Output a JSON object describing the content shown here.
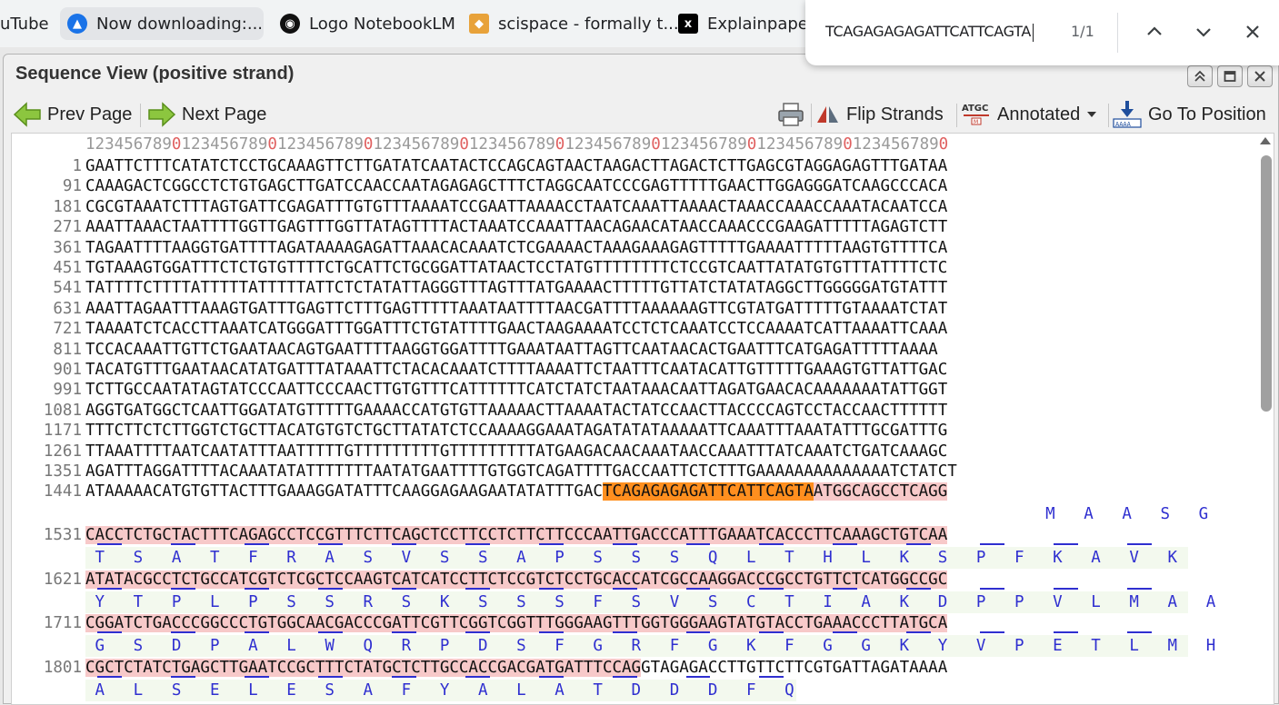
{
  "browser_tabs": [
    {
      "label": "uTube",
      "icon": "youtube-icon"
    },
    {
      "label": "Now downloading:...",
      "icon": "download-icon"
    },
    {
      "label": "Logo NotebookLM",
      "icon": "notebooklm-icon"
    },
    {
      "label": "scispace - formally t...",
      "icon": "scispace-icon"
    },
    {
      "label": "Explainpaper",
      "icon": "explainpaper-icon"
    }
  ],
  "find_bar": {
    "query": "TCAGAGAGAGATTCATTCAGTA",
    "count": "1/1"
  },
  "window": {
    "title": "Sequence View (positive strand)"
  },
  "toolbar": {
    "prev_page": "Prev Page",
    "next_page": "Next Page",
    "flip_strands": "Flip Strands",
    "annotated": "Annotated",
    "go_to_position": "Go To Position"
  },
  "ruler": "123456789012345678901234567890123456789012345678901234567890123456789012345678901234567890",
  "rows": [
    {
      "num": "1",
      "seq": "GAATTCTTTCATATCTCCTGCAAAGTTCTTGATATCAATACTCCAGCAGTAACTAAGACTTAGACTCTTGAGCGTAGGAGAGTTTGATAA"
    },
    {
      "num": "91",
      "seq": "CAAAGACTCGGCCTCTGTGAGCTTGATCCAACCAATAGAGAGCTTTCTAGGCAATCCCGAGTTTTTGAACTTGGAGGGATCAAGCCCACA"
    },
    {
      "num": "181",
      "seq": "CGCGTAAATCTTTAGTGATTCGAGATTTGTGTTTAAAATCCGAATTAAAACCTAATCAAATTAAAACTAAACCAAACCAAATACAATCCA"
    },
    {
      "num": "271",
      "seq": "AAATTAAACTAATTTTGGTTGAGTTTGGTTATAGTTTTACTAAATCCAAATTAACAGAACATAACCAAACCCGAAGATTTTTAGAGTCTT"
    },
    {
      "num": "361",
      "seq": "TAGAATTTTAAGGTGATTTTAGATAAAAGAGATTAAACACAAATCTCGAAAACTAAAGAAAGAGTTTTTGAAAATTTTTAAGTGTTTTCA"
    },
    {
      "num": "451",
      "seq": "TGTAAAGTGGATTTCTCTGTGTTTTCTGCATTCTGCGGATTATAACTCCTATGTTTTTTTTCTCCGTCAATTATATGTGTTTATTTTCTC"
    },
    {
      "num": "541",
      "seq": "TATTTTCTTTTATTTTTATTTTTATTCTCTATATTAGGGTTTAGTTTATGAAAACTTTTTGTTATCTATATAGGCTTGGGGGATGTATTT"
    },
    {
      "num": "631",
      "seq": "AAATTAGAATTTAAAGTGATTTGAGTTCTTTGAGTTTTTAAATAATTTTAACGATTTTAAAAAAGTTCGTATGATTTTTGTAAAATCTAT"
    },
    {
      "num": "721",
      "seq": "TAAAATCTCACCTTAAATCATGGGATTTGGATTTCTGTATTTTGAACTAAGAAAATCCTCTCAAATCCTCCAAAATCATTAAAATTCAAA"
    },
    {
      "num": "811",
      "seq": "TCCACAAATTGTTCTGAATAACAGTGAATTTTAAGGTGGATTTTGAAATAATTAGTTCAATAACACTGAATTTCATGAGATTTTTAAAA"
    },
    {
      "num": "901",
      "seq": "TACATGTTTGAATAACATATGATTTATAAATTCTACACAAATCTTTTAAAATTCTAATTTCAATACATTGTTTTTGAAAGTGTTATTGAC"
    },
    {
      "num": "991",
      "seq": "TCTTGCCAATATAGTATCCCAATTCCCAACTTGTGTTTCATTTTTTCATCTATCTAATAAACAATTAGATGAACACAAAAAAATATTGGT"
    },
    {
      "num": "1081",
      "seq": "AGGTGATGGCTCAATTGGATATGTTTTTGAAAACCATGTGTTAAAAACTTAAAATACTATCCAACTTACCCCAGTCCTACCAACTTTTTT"
    },
    {
      "num": "1171",
      "seq": "TTTCTTCTCTTGGTCTGCTTACATGTGTCTGCTTATATCTCCAAAAGGAAATAGATATATAAAAATTCAAATTTAAATATTTGCGATTTG"
    },
    {
      "num": "1261",
      "seq": "TTAAATTTTAATCAATATTTAATTTTTGTTTTTTTTTGTTTTTTTTTATGAAGACAACAAATAACCAAATTTATCAAATCTGATCAAAGC"
    },
    {
      "num": "1351",
      "seq": "AGATTTAGGATTTTACAAATATATTTTTTTAATATGAATTTTGTGGTCAGATTTTGACCAATTCTCTTTGAAAAAAAAAAAAAATCTATCT"
    }
  ],
  "row_1441": {
    "num": "1441",
    "pre": "ATAAAAACATGTGTTACTTTGAAAGGATATTTCAAGGAGAAGAATATATTTGAC",
    "hit": "TCAGAGAGAGATTCATTCAGTA",
    "post": "ATGGCAGCCTCAGG"
  },
  "aa_1441": "                                                                        M   A   A   S   G",
  "cds_rows": [
    {
      "num": "1531",
      "seq": "CACCTCTGCTACTTTCAGAGCCTCCGTTTCTTCAGCTCCTTCCTCTTCTTCCCAATTGACCCATTTGAAATCACCCTTCAAAGCTGTCAA",
      "aa": " T   S   A   T   F   R   A   S   V   S   S   A   P   S   S   S   Q   L   T   H   L   K   S   P   F   K   A   V   K"
    },
    {
      "num": "1621",
      "seq": "ATATACGCCTCTGCCATCGTCTCGCTCCAAGTCATCATCCTTCTCCGTCTCCTGCACCATCGCCAAGGACCCGCCTGTTCTCATGGCCGC",
      "aa": " Y   T   P   L   P   S   S   R   S   K   S   S   S   F   S   V   S   C   T   I   A   K   D   P   P   V   L   M   A   A"
    },
    {
      "num": "1711",
      "seq": "CGGATCTGACCCGGCCCTGTGGCAACGACCCGATTCGTTCGGTCGGTTTGGGAAGTTTGGTGGGAAGTATGTACCTGAAACCCTTATGCA",
      "aa": " G   S   D   P   A   L   W   Q   R   P   D   S   F   G   R   F   G   K   F   G   G   K   Y   V   P   E   T   L   M   H"
    }
  ],
  "row_1801": {
    "num": "1801",
    "cds": "CGCTCTATCTGAGCTTGAATCCGCTTTCTATGCTCTTGCCACCGACGATGATTTCCAG",
    "post": "GTAGAGACCTTGTTCTTCGTGATTAGATAAAA"
  },
  "aa_1801": " A   L   S   E   L   E   S   A   F   Y   A   L   A   T   D   D   D   F   Q"
}
